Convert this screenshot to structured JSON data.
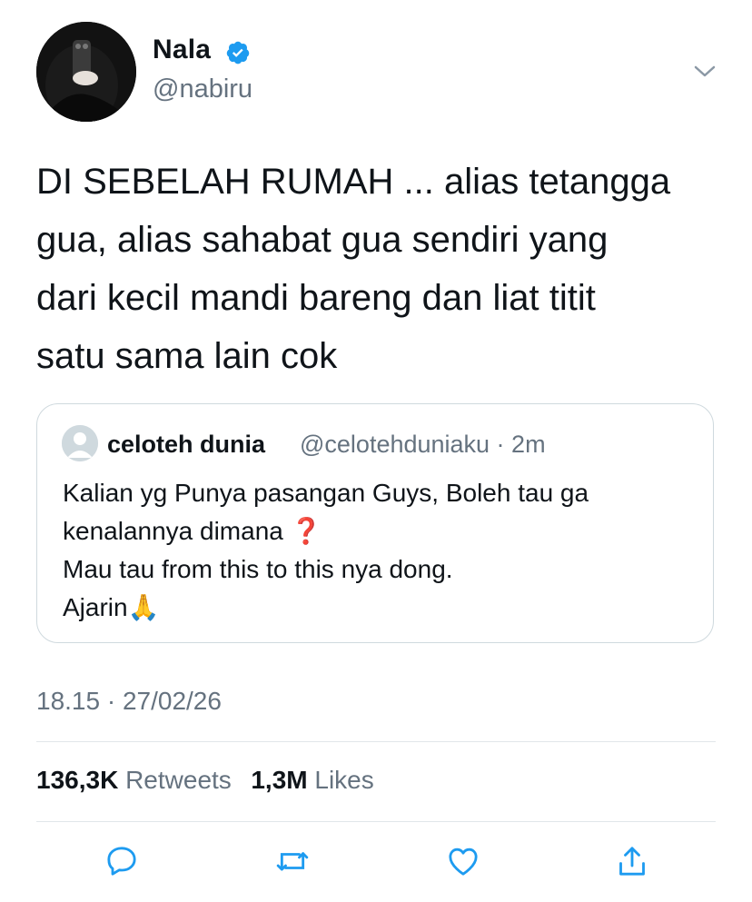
{
  "author": {
    "name": "Nala",
    "handle": "@nabiru",
    "verified": true,
    "avatar": "avatar"
  },
  "tweet": {
    "text": "DI SEBELAH RUMAH ... alias tetangga\ngua, alias sahabat gua sendiri yang\ndari kecil mandi bareng dan liat titit\nsatu sama lain cok"
  },
  "quote": {
    "name": "celoteh dunia",
    "handle": "@celotehduniaku · 2m",
    "lines": [
      "Kalian yg Punya pasangan Guys, Boleh tau ga",
      "kenalannya dimana ❓",
      "Mau tau from this to this nya dong.",
      "Ajarin🙏"
    ]
  },
  "timestamp": "18.15 · 27/02/26",
  "stats": {
    "retweets_count": "136,3K",
    "retweets_label": "Retweets",
    "likes_count": "1,3M",
    "likes_label": "Likes"
  },
  "colors": {
    "verified": "#1d9bf0",
    "secondary_text": "#65727f",
    "icon": "#1d9bf0"
  },
  "icons": {
    "reply": "reply-icon",
    "retweet": "retweet-icon",
    "like": "like-icon",
    "share": "share-icon",
    "menu": "chevron-down-icon"
  }
}
